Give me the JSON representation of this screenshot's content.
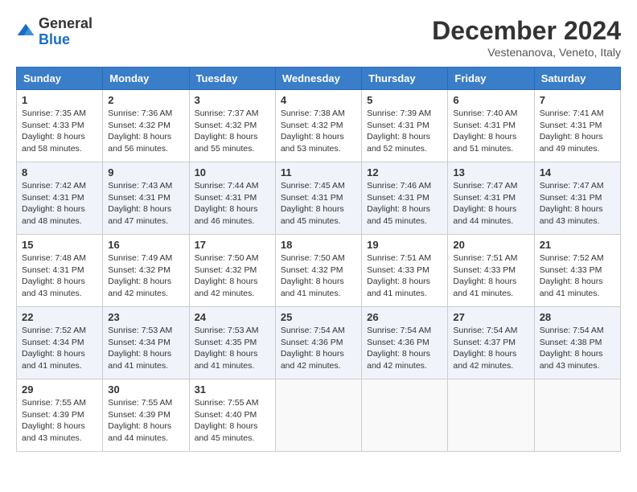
{
  "header": {
    "logo_general": "General",
    "logo_blue": "Blue",
    "title": "December 2024",
    "location": "Vestenanova, Veneto, Italy"
  },
  "weekdays": [
    "Sunday",
    "Monday",
    "Tuesday",
    "Wednesday",
    "Thursday",
    "Friday",
    "Saturday"
  ],
  "weeks": [
    [
      {
        "day": "1",
        "sunrise": "7:35 AM",
        "sunset": "4:33 PM",
        "daylight": "8 hours and 58 minutes."
      },
      {
        "day": "2",
        "sunrise": "7:36 AM",
        "sunset": "4:32 PM",
        "daylight": "8 hours and 56 minutes."
      },
      {
        "day": "3",
        "sunrise": "7:37 AM",
        "sunset": "4:32 PM",
        "daylight": "8 hours and 55 minutes."
      },
      {
        "day": "4",
        "sunrise": "7:38 AM",
        "sunset": "4:32 PM",
        "daylight": "8 hours and 53 minutes."
      },
      {
        "day": "5",
        "sunrise": "7:39 AM",
        "sunset": "4:31 PM",
        "daylight": "8 hours and 52 minutes."
      },
      {
        "day": "6",
        "sunrise": "7:40 AM",
        "sunset": "4:31 PM",
        "daylight": "8 hours and 51 minutes."
      },
      {
        "day": "7",
        "sunrise": "7:41 AM",
        "sunset": "4:31 PM",
        "daylight": "8 hours and 49 minutes."
      }
    ],
    [
      {
        "day": "8",
        "sunrise": "7:42 AM",
        "sunset": "4:31 PM",
        "daylight": "8 hours and 48 minutes."
      },
      {
        "day": "9",
        "sunrise": "7:43 AM",
        "sunset": "4:31 PM",
        "daylight": "8 hours and 47 minutes."
      },
      {
        "day": "10",
        "sunrise": "7:44 AM",
        "sunset": "4:31 PM",
        "daylight": "8 hours and 46 minutes."
      },
      {
        "day": "11",
        "sunrise": "7:45 AM",
        "sunset": "4:31 PM",
        "daylight": "8 hours and 45 minutes."
      },
      {
        "day": "12",
        "sunrise": "7:46 AM",
        "sunset": "4:31 PM",
        "daylight": "8 hours and 45 minutes."
      },
      {
        "day": "13",
        "sunrise": "7:47 AM",
        "sunset": "4:31 PM",
        "daylight": "8 hours and 44 minutes."
      },
      {
        "day": "14",
        "sunrise": "7:47 AM",
        "sunset": "4:31 PM",
        "daylight": "8 hours and 43 minutes."
      }
    ],
    [
      {
        "day": "15",
        "sunrise": "7:48 AM",
        "sunset": "4:31 PM",
        "daylight": "8 hours and 43 minutes."
      },
      {
        "day": "16",
        "sunrise": "7:49 AM",
        "sunset": "4:32 PM",
        "daylight": "8 hours and 42 minutes."
      },
      {
        "day": "17",
        "sunrise": "7:50 AM",
        "sunset": "4:32 PM",
        "daylight": "8 hours and 42 minutes."
      },
      {
        "day": "18",
        "sunrise": "7:50 AM",
        "sunset": "4:32 PM",
        "daylight": "8 hours and 41 minutes."
      },
      {
        "day": "19",
        "sunrise": "7:51 AM",
        "sunset": "4:33 PM",
        "daylight": "8 hours and 41 minutes."
      },
      {
        "day": "20",
        "sunrise": "7:51 AM",
        "sunset": "4:33 PM",
        "daylight": "8 hours and 41 minutes."
      },
      {
        "day": "21",
        "sunrise": "7:52 AM",
        "sunset": "4:33 PM",
        "daylight": "8 hours and 41 minutes."
      }
    ],
    [
      {
        "day": "22",
        "sunrise": "7:52 AM",
        "sunset": "4:34 PM",
        "daylight": "8 hours and 41 minutes."
      },
      {
        "day": "23",
        "sunrise": "7:53 AM",
        "sunset": "4:34 PM",
        "daylight": "8 hours and 41 minutes."
      },
      {
        "day": "24",
        "sunrise": "7:53 AM",
        "sunset": "4:35 PM",
        "daylight": "8 hours and 41 minutes."
      },
      {
        "day": "25",
        "sunrise": "7:54 AM",
        "sunset": "4:36 PM",
        "daylight": "8 hours and 42 minutes."
      },
      {
        "day": "26",
        "sunrise": "7:54 AM",
        "sunset": "4:36 PM",
        "daylight": "8 hours and 42 minutes."
      },
      {
        "day": "27",
        "sunrise": "7:54 AM",
        "sunset": "4:37 PM",
        "daylight": "8 hours and 42 minutes."
      },
      {
        "day": "28",
        "sunrise": "7:54 AM",
        "sunset": "4:38 PM",
        "daylight": "8 hours and 43 minutes."
      }
    ],
    [
      {
        "day": "29",
        "sunrise": "7:55 AM",
        "sunset": "4:39 PM",
        "daylight": "8 hours and 43 minutes."
      },
      {
        "day": "30",
        "sunrise": "7:55 AM",
        "sunset": "4:39 PM",
        "daylight": "8 hours and 44 minutes."
      },
      {
        "day": "31",
        "sunrise": "7:55 AM",
        "sunset": "4:40 PM",
        "daylight": "8 hours and 45 minutes."
      },
      null,
      null,
      null,
      null
    ]
  ]
}
